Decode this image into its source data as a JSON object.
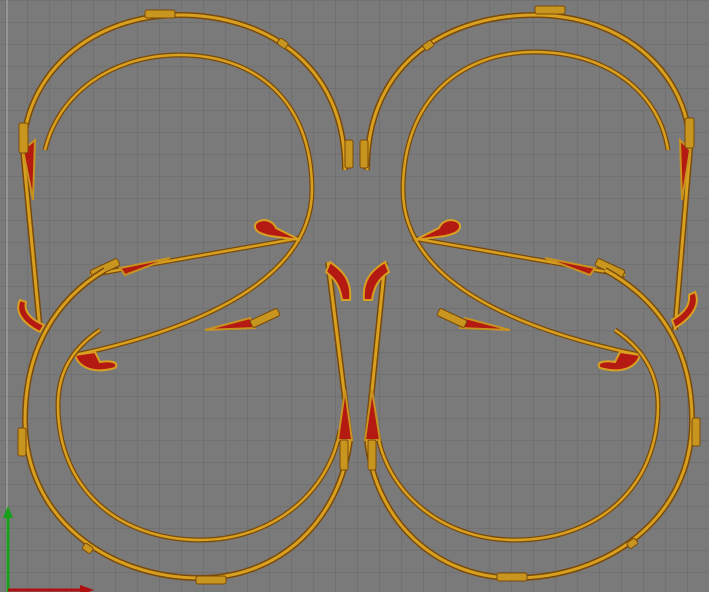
{
  "viewport": {
    "bed_color": "#7a7a7a",
    "grid_minor_color": "#6a6a6a",
    "grid_major_color": "#5d5d5d",
    "bed_edge_color": "#9a9a9a"
  },
  "print_colors": {
    "perimeter_outer": "#7a4a0a",
    "perimeter_inner": "#d8a020",
    "infill_fill": "#b41a12",
    "infill_outline": "#c8921f",
    "tab_fill": "#c8961e",
    "tab_highlight": "#e6d290"
  },
  "axes": {
    "x_axis_color": "#b01010",
    "y_axis_color": "#18a018",
    "x_axis_icon": "x-axis-arrow",
    "y_axis_icon": "y-axis-arrow"
  }
}
